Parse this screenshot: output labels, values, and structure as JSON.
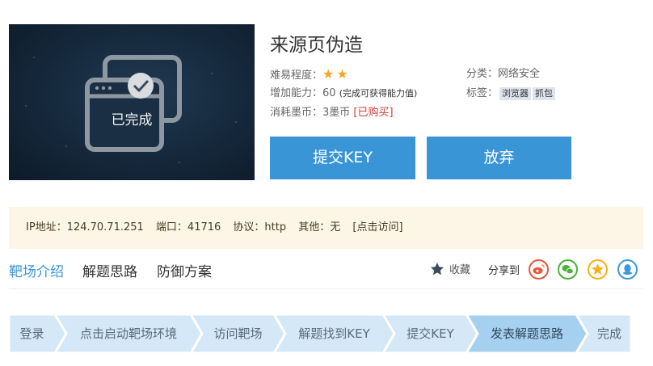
{
  "challenge": {
    "title": "来源页伪造",
    "status_overlay": "已完成",
    "difficulty_label": "难易程度：",
    "difficulty_stars": 2,
    "ability_label": "增加能力：60",
    "ability_note": "(完成可获得能力值)",
    "cost_label": "消耗墨币：3墨币",
    "cost_status": "[已购买]",
    "category_label": "分类：网络安全",
    "tags_label": "标签：",
    "tags": [
      "浏览器",
      "抓包"
    ]
  },
  "actions": {
    "submit_key": "提交KEY",
    "give_up": "放弃"
  },
  "environment": {
    "ip": "IP地址：124.70.71.251",
    "port": "端口：41716",
    "protocol": "协议：http",
    "other": "其他：无",
    "visit_link": "[点击访问]"
  },
  "tabs": {
    "intro": "靶场介绍",
    "solution": "解题思路",
    "defense": "防御方案"
  },
  "favorite_label": "收藏",
  "share_label": "分享到",
  "share_icons": [
    "weibo-icon",
    "wechat-icon",
    "qzone-icon",
    "qq-icon"
  ],
  "steps": [
    "登录",
    "点击启动靶场环境",
    "访问靶场",
    "解题找到KEY",
    "提交KEY",
    "发表解题思路",
    "完成"
  ],
  "active_step": 5,
  "colors": {
    "accent": "#3a95d6",
    "star": "#f6a623",
    "step_bg": "#d4e8f7",
    "step_active_bg": "#a6d0f0",
    "env_bg": "#fdf6e7"
  }
}
